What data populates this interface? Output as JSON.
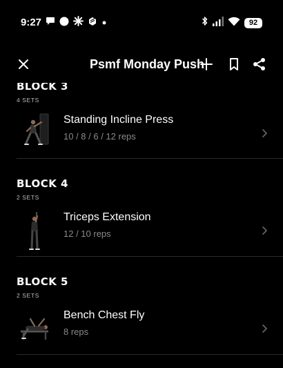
{
  "status_bar": {
    "time": "9:27",
    "battery": "92",
    "left_icons": [
      "chat-bubble-icon",
      "circle-icon",
      "pinwheel-icon",
      "package-icon",
      "dot-icon"
    ],
    "right_icons": [
      "bluetooth-icon",
      "signal-icon",
      "wifi-icon",
      "battery-icon"
    ]
  },
  "header": {
    "title": "Psmf Monday Push",
    "icons": [
      "close-icon",
      "plus-icon",
      "bookmark-icon",
      "share-icon"
    ]
  },
  "blocks": [
    {
      "title": "BLOCK 3",
      "sets": "4 SETS",
      "exercise": {
        "name": "Standing Incline Press",
        "reps": "10 / 8 / 6 / 12 reps"
      }
    },
    {
      "title": "BLOCK 4",
      "sets": "2 SETS",
      "exercise": {
        "name": "Triceps Extension",
        "reps": "12 / 10 reps"
      }
    },
    {
      "title": "BLOCK 5",
      "sets": "2 SETS",
      "exercise": {
        "name": "Bench Chest Fly",
        "reps": "8 reps"
      }
    }
  ],
  "colors": {
    "background": "#000000",
    "text_primary": "#ffffff",
    "text_secondary": "#8a8a8a",
    "divider": "#2a2a2a"
  }
}
